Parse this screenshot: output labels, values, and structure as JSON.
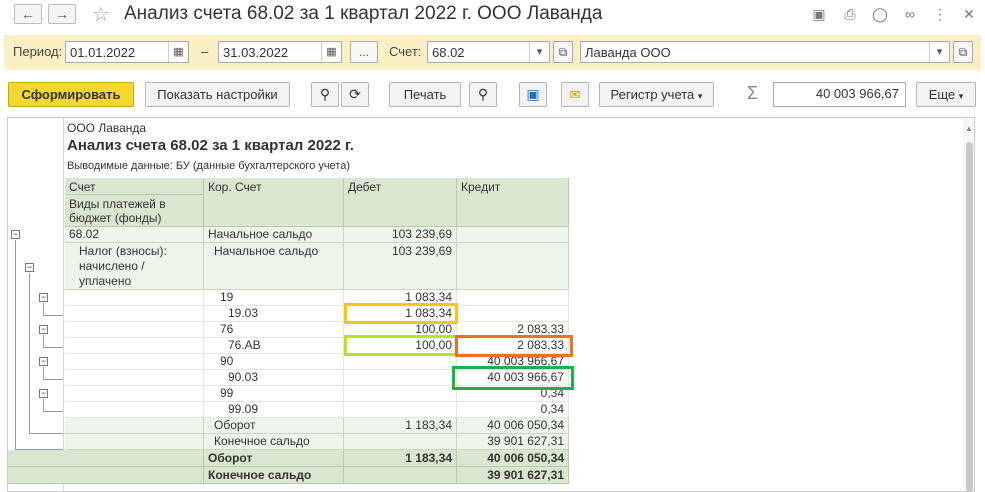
{
  "window": {
    "title": "Анализ счета 68.02 за 1 квартал 2022 г. ООО Лаванда",
    "icons": [
      "back-arrow",
      "forward-arrow",
      "star",
      "save-disk",
      "print",
      "zoom",
      "link",
      "more-vertical",
      "close"
    ]
  },
  "filters": {
    "period_label": "Период:",
    "date_from": "01.01.2022",
    "dash": "–",
    "date_to": "31.03.2022",
    "ellipsis": "...",
    "account_label": "Счет:",
    "account": "68.02",
    "organization": "Лаванда ООО"
  },
  "toolbar": {
    "generate": "Сформировать",
    "show_settings": "Показать настройки",
    "print": "Печать",
    "registry": "Регистр учета",
    "sum_value": "40 003 966,67",
    "more": "Еще"
  },
  "report": {
    "company": "ООО Лаванда",
    "heading": "Анализ счета 68.02 за 1 квартал 2022 г.",
    "output_data": "Выводимые данные:  БУ (данные бухгалтерского учета)",
    "columns": {
      "account": "Счет",
      "payment_types": "Виды платежей в бюджет (фонды)",
      "corr_account": "Кор. Счет",
      "debit": "Дебет",
      "credit": "Кредит"
    },
    "rows": [
      {
        "account": "68.02",
        "corr": "Начальное сальдо",
        "debit": "103 239,69",
        "credit": ""
      },
      {
        "account": "Налог (взносы): начислено / уплачено",
        "corr": "Начальное сальдо",
        "debit": "103 239,69",
        "credit": ""
      },
      {
        "account": "",
        "corr": "19",
        "debit": "1 083,34",
        "credit": ""
      },
      {
        "account": "",
        "corr": "19.03",
        "debit": "1 083,34",
        "credit": ""
      },
      {
        "account": "",
        "corr": "76",
        "debit": "100,00",
        "credit": "2 083,33"
      },
      {
        "account": "",
        "corr": "76.АВ",
        "debit": "100,00",
        "credit": "2 083,33"
      },
      {
        "account": "",
        "corr": "90",
        "debit": "",
        "credit": "40 003 966,67"
      },
      {
        "account": "",
        "corr": "90.03",
        "debit": "",
        "credit": "40 003 966,67"
      },
      {
        "account": "",
        "corr": "99",
        "debit": "",
        "credit": "0,34"
      },
      {
        "account": "",
        "corr": "99.09",
        "debit": "",
        "credit": "0,34"
      },
      {
        "account": "",
        "corr": "Оборот",
        "debit": "1 183,34",
        "credit": "40 006 050,34"
      },
      {
        "account": "",
        "corr": "Конечное сальдо",
        "debit": "",
        "credit": "39 901 627,31"
      }
    ],
    "totals": [
      {
        "label": "Оборот",
        "debit": "1 183,34",
        "credit": "40 006 050,34"
      },
      {
        "label": "Конечное сальдо",
        "debit": "",
        "credit": "39 901 627,31"
      }
    ]
  },
  "highlight_colors": {
    "yellow": "#f2c811",
    "lime": "#b5e61d",
    "orange": "#e8741c",
    "green": "#1fb04a"
  }
}
